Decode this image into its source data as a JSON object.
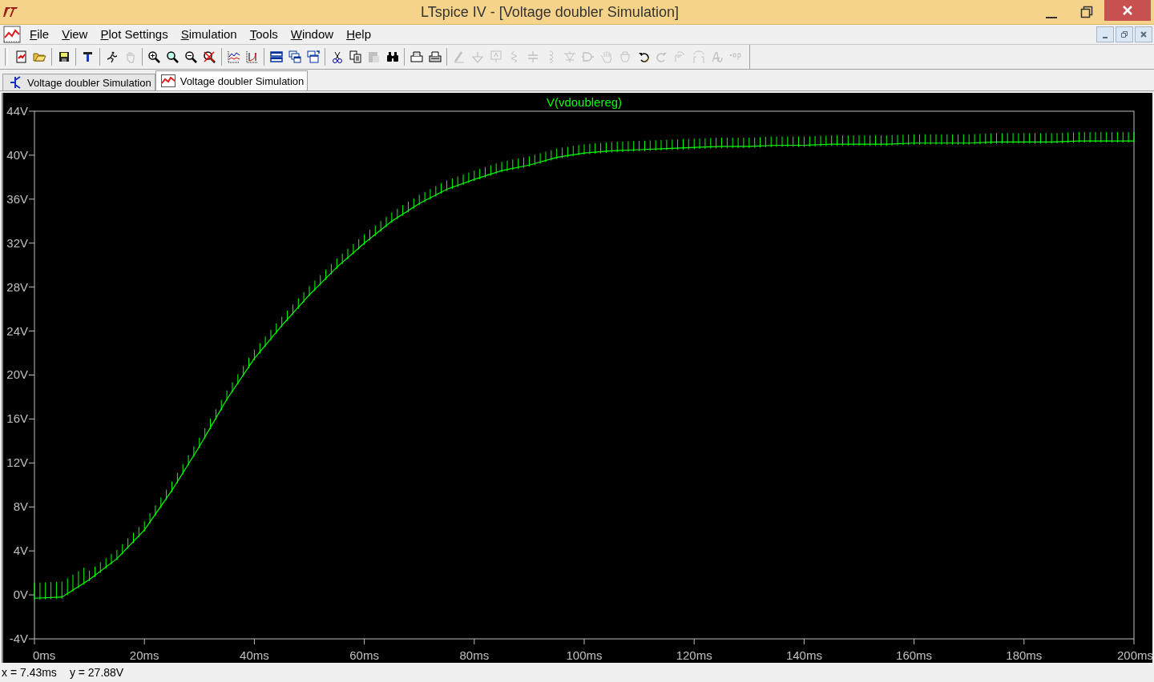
{
  "window": {
    "title": "LTspice IV - [Voltage doubler Simulation]"
  },
  "menu": [
    "File",
    "View",
    "Plot Settings",
    "Simulation",
    "Tools",
    "Window",
    "Help"
  ],
  "toolbar": [
    {
      "kind": "new",
      "disabled": false
    },
    {
      "kind": "open",
      "disabled": false
    },
    {
      "kind": "sep"
    },
    {
      "kind": "save",
      "disabled": false
    },
    {
      "kind": "sep"
    },
    {
      "kind": "hammer",
      "disabled": false
    },
    {
      "kind": "sep"
    },
    {
      "kind": "run",
      "disabled": false
    },
    {
      "kind": "halt",
      "disabled": true
    },
    {
      "kind": "sep"
    },
    {
      "kind": "zoom-in",
      "disabled": false
    },
    {
      "kind": "zoom",
      "disabled": false
    },
    {
      "kind": "zoom-out",
      "disabled": false
    },
    {
      "kind": "zoom-cancel",
      "disabled": false
    },
    {
      "kind": "sep"
    },
    {
      "kind": "autorange",
      "disabled": false
    },
    {
      "kind": "marker",
      "disabled": false
    },
    {
      "kind": "sep"
    },
    {
      "kind": "tile-h",
      "disabled": false
    },
    {
      "kind": "cascade",
      "disabled": false
    },
    {
      "kind": "tile-v",
      "disabled": false
    },
    {
      "kind": "sep"
    },
    {
      "kind": "cut",
      "disabled": false
    },
    {
      "kind": "copy",
      "disabled": false
    },
    {
      "kind": "paste",
      "disabled": true
    },
    {
      "kind": "find",
      "disabled": false
    },
    {
      "kind": "sep"
    },
    {
      "kind": "print-setup",
      "disabled": false
    },
    {
      "kind": "print",
      "disabled": false
    },
    {
      "kind": "sep"
    },
    {
      "kind": "wire",
      "disabled": true
    },
    {
      "kind": "ground",
      "disabled": true
    },
    {
      "kind": "label",
      "disabled": true
    },
    {
      "kind": "resistor",
      "disabled": true
    },
    {
      "kind": "capacitor",
      "disabled": true
    },
    {
      "kind": "inductor",
      "disabled": true
    },
    {
      "kind": "diode",
      "disabled": true
    },
    {
      "kind": "component",
      "disabled": true
    },
    {
      "kind": "move",
      "disabled": true
    },
    {
      "kind": "drag",
      "disabled": true
    },
    {
      "kind": "undo",
      "disabled": false
    },
    {
      "kind": "redo",
      "disabled": true
    },
    {
      "kind": "rotate",
      "disabled": true
    },
    {
      "kind": "mirror",
      "disabled": true
    },
    {
      "kind": "text",
      "disabled": true
    },
    {
      "kind": "directive",
      "disabled": true
    }
  ],
  "tabs": [
    {
      "label": "Voltage doubler Simulation",
      "kind": "schematic",
      "selected": false
    },
    {
      "label": "Voltage doubler Simulation",
      "kind": "waveform",
      "selected": true
    }
  ],
  "plot": {
    "chart_data": {
      "type": "line",
      "x": [
        0,
        5,
        10,
        15,
        20,
        25,
        30,
        35,
        40,
        45,
        50,
        55,
        60,
        65,
        70,
        75,
        80,
        85,
        90,
        95,
        100,
        105,
        110,
        115,
        120,
        125,
        130,
        135,
        140,
        145,
        150,
        155,
        160,
        165,
        170,
        175,
        180,
        185,
        190,
        195,
        200
      ],
      "series": [
        {
          "name": "V(vdoublereg)",
          "color": "#00ff00",
          "values": [
            -0.3,
            -0.2,
            1.4,
            3.3,
            5.9,
            9.5,
            13.5,
            17.8,
            21.5,
            24.5,
            27.3,
            29.8,
            32.0,
            34.0,
            35.6,
            36.9,
            37.8,
            38.6,
            39.1,
            39.8,
            40.2,
            40.4,
            40.5,
            40.6,
            40.7,
            40.8,
            40.8,
            40.9,
            40.9,
            41.0,
            41.0,
            41.0,
            41.1,
            41.1,
            41.1,
            41.2,
            41.2,
            41.2,
            41.3,
            41.3,
            41.3
          ]
        }
      ],
      "xlim": [
        0,
        200
      ],
      "ylim": [
        -4,
        44
      ],
      "xticks": [
        {
          "value": 0,
          "label": "0ms"
        },
        {
          "value": 20,
          "label": "20ms"
        },
        {
          "value": 40,
          "label": "40ms"
        },
        {
          "value": 60,
          "label": "60ms"
        },
        {
          "value": 80,
          "label": "80ms"
        },
        {
          "value": 100,
          "label": "100ms"
        },
        {
          "value": 120,
          "label": "120ms"
        },
        {
          "value": 140,
          "label": "140ms"
        },
        {
          "value": 160,
          "label": "160ms"
        },
        {
          "value": 180,
          "label": "180ms"
        },
        {
          "value": 200,
          "label": "200ms"
        }
      ],
      "yticks": [
        {
          "value": -4,
          "label": "-4V"
        },
        {
          "value": 0,
          "label": "0V"
        },
        {
          "value": 4,
          "label": "4V"
        },
        {
          "value": 8,
          "label": "8V"
        },
        {
          "value": 12,
          "label": "12V"
        },
        {
          "value": 16,
          "label": "16V"
        },
        {
          "value": 20,
          "label": "20V"
        },
        {
          "value": 24,
          "label": "24V"
        },
        {
          "value": 28,
          "label": "28V"
        },
        {
          "value": 32,
          "label": "32V"
        },
        {
          "value": 36,
          "label": "36V"
        },
        {
          "value": 40,
          "label": "40V"
        },
        {
          "value": 44,
          "label": "44V"
        }
      ]
    }
  },
  "status_bar": {
    "x_readout": "x = 7.43ms",
    "y_readout": "y = 27.88V"
  }
}
